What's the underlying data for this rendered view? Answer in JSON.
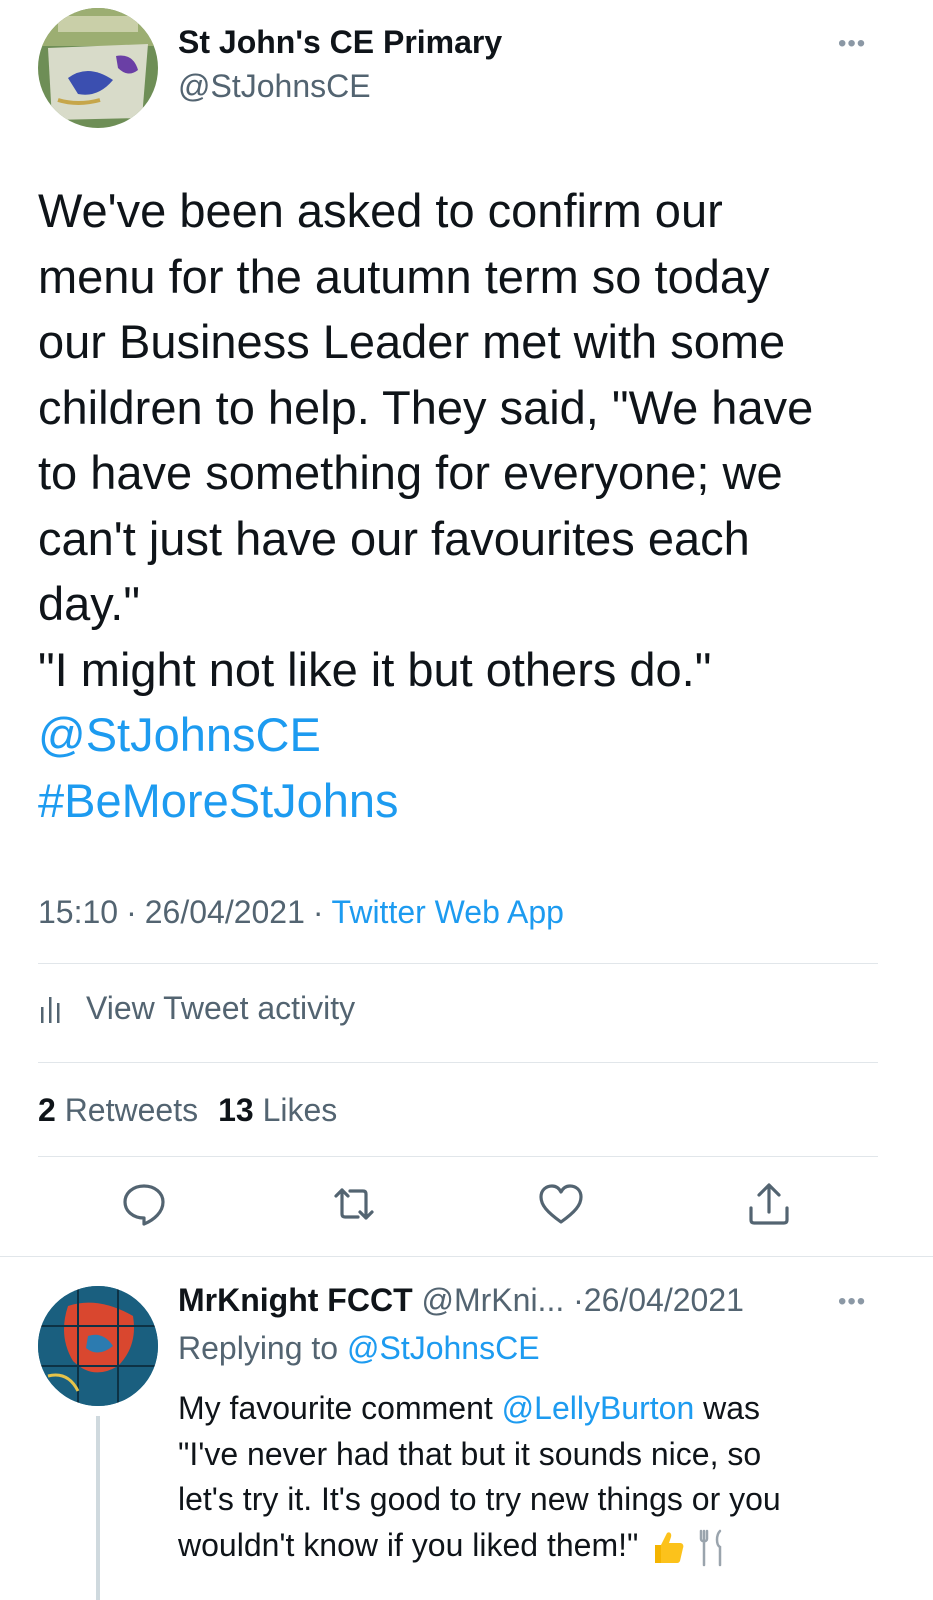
{
  "tweet": {
    "author_name": "St John's CE Primary",
    "author_handle": "@StJohnsCE",
    "more_label": "•••",
    "body_lines": [
      "We've been asked to confirm our",
      "menu for the autumn term so today",
      "our Business Leader met with some",
      "children to help. They said, \"We have",
      "to have something for everyone; we",
      "can't just have our favourites each",
      "day.\"",
      "\"I might not like it but others do.\""
    ],
    "mention": "@StJohnsCE",
    "hashtag": "#BeMoreStJohns",
    "time": "15:10",
    "date": "26/04/2021",
    "separator": "·",
    "source": "Twitter Web App",
    "activity_label": "View Tweet activity",
    "retweets_count": "2",
    "retweets_label": "Retweets",
    "likes_count": "13",
    "likes_label": "Likes",
    "action_icons": [
      "reply-icon",
      "retweet-icon",
      "like-icon",
      "share-icon"
    ]
  },
  "reply": {
    "author_name": "MrKnight FCCT",
    "author_handle": "@MrKni...",
    "date": "26/04/2021",
    "separator": "·",
    "more_label": "•••",
    "replying_prefix": "Replying to",
    "replying_handle": "@StJohnsCE",
    "text_line1_before": "My favourite comment",
    "text_line1_mention": "@LellyBurton",
    "text_line1_after": "was",
    "text_line2": "\"I've never had that but it sounds nice, so",
    "text_line3": "let's try it. It's good to try new things or you",
    "text_line4": "wouldn't know if you liked them!\""
  },
  "colors": {
    "link": "#1d9bf0",
    "text": "#0f1419",
    "secondary": "#536471",
    "divider": "#e1e6ea"
  }
}
